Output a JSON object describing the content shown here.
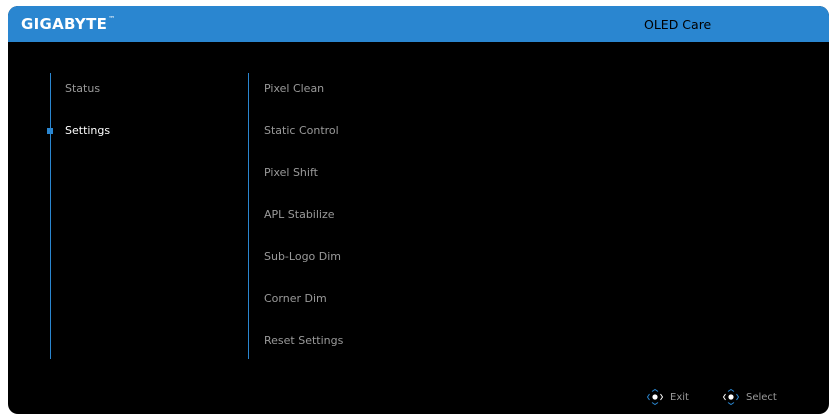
{
  "header": {
    "brand": "GIGABYTE",
    "brand_tm": "™",
    "title": "OLED Care"
  },
  "nav": {
    "items": [
      {
        "label": "Status",
        "active": false
      },
      {
        "label": "Settings",
        "active": true
      }
    ]
  },
  "options": {
    "items": [
      {
        "label": "Pixel Clean"
      },
      {
        "label": "Static Control"
      },
      {
        "label": "Pixel Shift"
      },
      {
        "label": "APL Stabilize"
      },
      {
        "label": "Sub-Logo Dim"
      },
      {
        "label": "Corner Dim"
      },
      {
        "label": "Reset Settings"
      }
    ]
  },
  "footer": {
    "exit_label": "Exit",
    "exit_icon": "joystick-icon",
    "select_label": "Select",
    "select_icon": "joystick-icon"
  },
  "colors": {
    "accent": "#2a86d0",
    "background": "#000000",
    "text_inactive": "#9a9a9a",
    "text_active": "#ffffff"
  }
}
